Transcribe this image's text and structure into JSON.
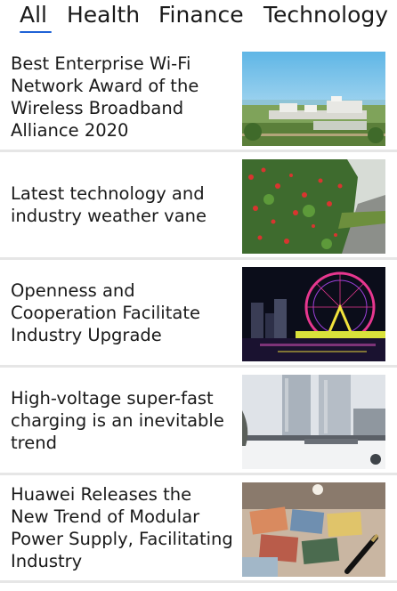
{
  "tabs": [
    {
      "label": "All",
      "selected": true
    },
    {
      "label": "Health",
      "selected": false
    },
    {
      "label": "Finance",
      "selected": false
    },
    {
      "label": "Technology",
      "selected": false
    }
  ],
  "accent_color": "#1f62d6",
  "articles": [
    {
      "title": "Best Enterprise Wi-Fi Network Award of the Wireless Broadband Alliance 2020",
      "image": "coastal-campus-photo"
    },
    {
      "title": "Latest technology and industry weather vane",
      "image": "flowering-hedge-road-photo"
    },
    {
      "title": "Openness and Cooperation Facilitate Industry Upgrade",
      "image": "ferris-wheel-night-photo"
    },
    {
      "title": "High-voltage super-fast charging is an inevitable trend",
      "image": "snowy-city-towers-photo"
    },
    {
      "title": "Huawei Releases the New Trend of Modular Power Supply, Facilitating Industry",
      "image": "desk-photos-pen-photo"
    }
  ]
}
